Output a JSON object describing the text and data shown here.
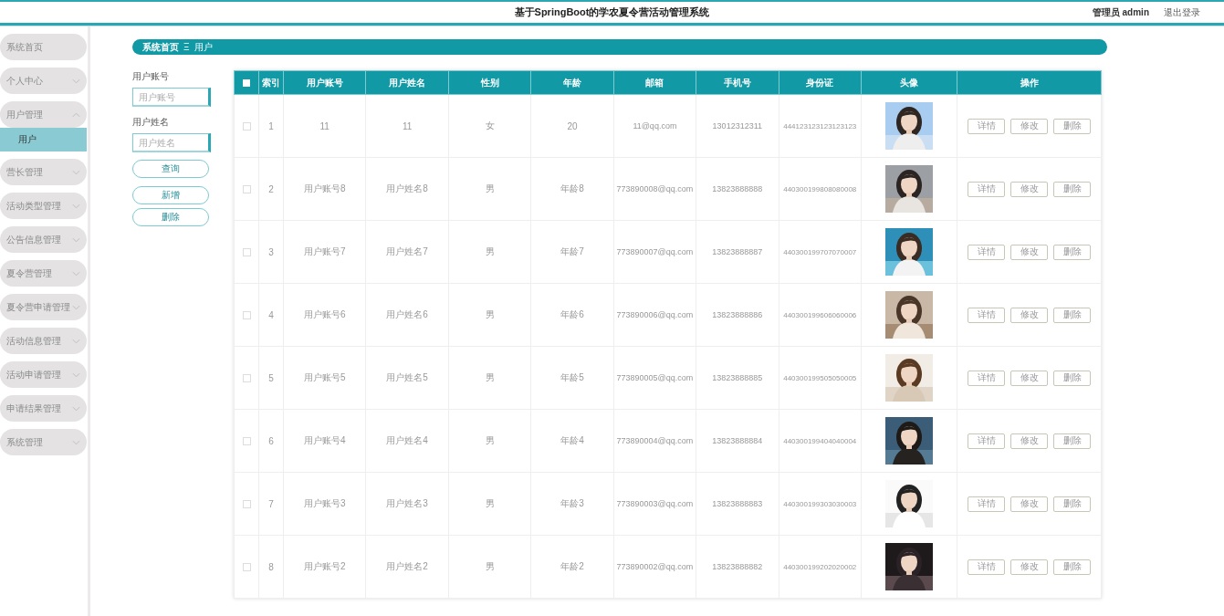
{
  "header": {
    "title": "基于SpringBoot的学农夏令营活动管理系统",
    "user": "管理员 admin",
    "logout": "退出登录"
  },
  "sidebar": {
    "items": [
      {
        "label": "系统首页",
        "expandable": false
      },
      {
        "label": "个人中心",
        "expandable": true,
        "expanded": false
      },
      {
        "label": "用户管理",
        "expandable": true,
        "expanded": true,
        "children": [
          {
            "label": "用户",
            "selected": true
          }
        ]
      },
      {
        "label": "营长管理",
        "expandable": true,
        "expanded": false
      },
      {
        "label": "活动类型管理",
        "expandable": true,
        "expanded": false
      },
      {
        "label": "公告信息管理",
        "expandable": true,
        "expanded": false
      },
      {
        "label": "夏令营管理",
        "expandable": true,
        "expanded": false
      },
      {
        "label": "夏令营申请管理",
        "expandable": true,
        "expanded": false
      },
      {
        "label": "活动信息管理",
        "expandable": true,
        "expanded": false
      },
      {
        "label": "活动申请管理",
        "expandable": true,
        "expanded": false
      },
      {
        "label": "申请结果管理",
        "expandable": true,
        "expanded": false
      },
      {
        "label": "系统管理",
        "expandable": true,
        "expanded": false
      }
    ]
  },
  "breadcrumb": {
    "home": "系统首页",
    "separator": "Ξ",
    "current": "用户"
  },
  "search": {
    "fields": [
      {
        "label": "用户账号",
        "placeholder": "用户账号"
      },
      {
        "label": "用户姓名",
        "placeholder": "用户姓名"
      }
    ],
    "buttons": [
      "查询",
      "新增",
      "删除"
    ]
  },
  "table": {
    "all_checked": false,
    "columns": [
      "索引",
      "用户账号",
      "用户姓名",
      "性别",
      "年龄",
      "邮箱",
      "手机号",
      "身份证",
      "头像",
      "操作"
    ],
    "rows": [
      {
        "checked": false,
        "index": "1",
        "account": "11",
        "name": "11",
        "gender": "女",
        "age": "20",
        "email": "11@qq.com",
        "phone": "13012312311",
        "id_card": "444123123123123123",
        "actions": [
          "详情",
          "修改",
          "删除"
        ]
      },
      {
        "checked": false,
        "index": "2",
        "account": "用户账号8",
        "name": "用户姓名8",
        "gender": "男",
        "age": "年龄8",
        "email": "773890008@qq.com",
        "phone": "13823888888",
        "id_card": "440300199808080008",
        "actions": [
          "详情",
          "修改",
          "删除"
        ]
      },
      {
        "checked": false,
        "index": "3",
        "account": "用户账号7",
        "name": "用户姓名7",
        "gender": "男",
        "age": "年龄7",
        "email": "773890007@qq.com",
        "phone": "13823888887",
        "id_card": "440300199707070007",
        "actions": [
          "详情",
          "修改",
          "删除"
        ]
      },
      {
        "checked": false,
        "index": "4",
        "account": "用户账号6",
        "name": "用户姓名6",
        "gender": "男",
        "age": "年龄6",
        "email": "773890006@qq.com",
        "phone": "13823888886",
        "id_card": "440300199606060006",
        "actions": [
          "详情",
          "修改",
          "删除"
        ]
      },
      {
        "checked": false,
        "index": "5",
        "account": "用户账号5",
        "name": "用户姓名5",
        "gender": "男",
        "age": "年龄5",
        "email": "773890005@qq.com",
        "phone": "13823888885",
        "id_card": "440300199505050005",
        "actions": [
          "详情",
          "修改",
          "删除"
        ]
      },
      {
        "checked": false,
        "index": "6",
        "account": "用户账号4",
        "name": "用户姓名4",
        "gender": "男",
        "age": "年龄4",
        "email": "773890004@qq.com",
        "phone": "13823888884",
        "id_card": "440300199404040004",
        "actions": [
          "详情",
          "修改",
          "删除"
        ]
      },
      {
        "checked": false,
        "index": "7",
        "account": "用户账号3",
        "name": "用户姓名3",
        "gender": "男",
        "age": "年龄3",
        "email": "773890003@qq.com",
        "phone": "13823888883",
        "id_card": "440300199303030003",
        "actions": [
          "详情",
          "修改",
          "删除"
        ]
      },
      {
        "checked": false,
        "index": "8",
        "account": "用户账号2",
        "name": "用户姓名2",
        "gender": "男",
        "age": "年龄2",
        "email": "773890002@qq.com",
        "phone": "13823888882",
        "id_card": "440300199202020002",
        "actions": [
          "详情",
          "修改",
          "删除"
        ]
      }
    ]
  }
}
